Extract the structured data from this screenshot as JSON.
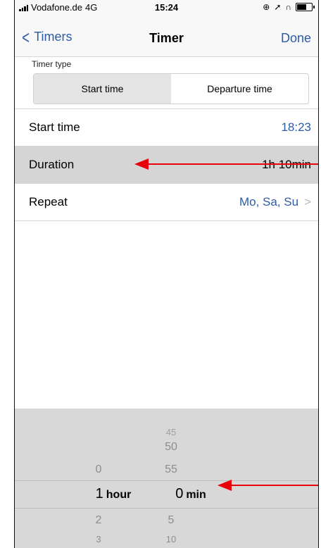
{
  "status_bar": {
    "carrier": "Vodafone.de",
    "network": "4G",
    "time": "15:24",
    "icons": [
      "signal-icon",
      "lock-rotation-icon",
      "location-icon",
      "headphones-icon",
      "battery-icon"
    ]
  },
  "nav": {
    "back_label": "Timers",
    "title": "Timer",
    "done_label": "Done"
  },
  "timer_type": {
    "label": "Timer type",
    "options": [
      "Start time",
      "Departure time"
    ],
    "selected": "Start time"
  },
  "rows": {
    "start_time": {
      "label": "Start time",
      "value": "18:23"
    },
    "duration": {
      "label": "Duration",
      "value": "1h 10min"
    },
    "repeat": {
      "label": "Repeat",
      "value": "Mo, Sa, Su",
      "chevron": ">"
    }
  },
  "picker": {
    "hours": {
      "above": "0",
      "selected": "1",
      "below": [
        "2",
        "3"
      ],
      "unit": "hour"
    },
    "minutes": {
      "above": [
        "45",
        "50",
        "55"
      ],
      "selected": "0",
      "below": [
        "5",
        "10"
      ],
      "unit": "min"
    }
  },
  "colors": {
    "accent": "#2d5ba6",
    "annotation": "#e8000b",
    "picker_bg": "#d8d8d8",
    "highlight_row": "#d5d5d5"
  }
}
